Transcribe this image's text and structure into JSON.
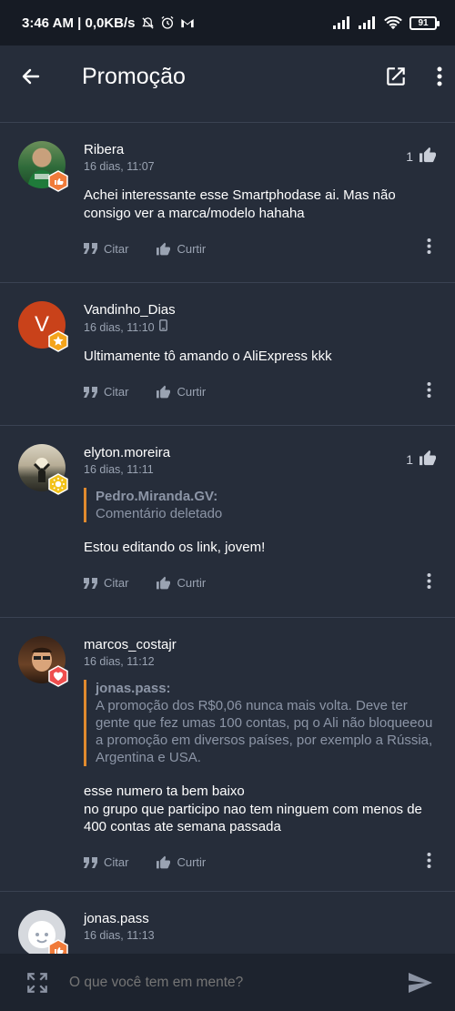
{
  "status_bar": {
    "time_speed": "3:46 AM | 0,0KB/s",
    "battery": "91"
  },
  "app_bar": {
    "title": "Promoção",
    "icons": [
      "back-arrow-icon",
      "open-external-icon",
      "more-vert-icon"
    ]
  },
  "comments": [
    {
      "user": "Ribera",
      "time": "16 dias, 11:07",
      "likes": "1",
      "text": "Achei interessante esse Smartphodase ai. Mas não consigo ver a marca/modelo hahaha",
      "cite_label": "Citar",
      "like_label": "Curtir"
    },
    {
      "user": "Vandinho_Dias",
      "avatar_letter": "V",
      "time": "16 dias, 11:10",
      "text": "Ultimamente tô amando o AliExpress kkk",
      "cite_label": "Citar",
      "like_label": "Curtir"
    },
    {
      "user": "elyton.moreira",
      "time": "16 dias, 11:11",
      "likes": "1",
      "quote_author": "Pedro.Miranda.GV:",
      "quote_text": "Comentário deletado",
      "text": "Estou editando os link, jovem!",
      "cite_label": "Citar",
      "like_label": "Curtir"
    },
    {
      "user": "marcos_costajr",
      "time": "16 dias, 11:12",
      "quote_author": "jonas.pass:",
      "quote_text": "A promoção dos R$0,06 nunca mais volta. Deve ter gente que fez umas 100 contas, pq o Ali não bloqueeou a promoção em diversos países, por exemplo a Rússia, Argentina e USA.",
      "text_lines": [
        "esse numero ta bem baixo",
        "no grupo que participo nao tem ninguem com menos de 400 contas ate semana passada"
      ],
      "cite_label": "Citar",
      "like_label": "Curtir"
    },
    {
      "user": "jonas.pass",
      "time": "16 dias, 11:13"
    }
  ],
  "input": {
    "placeholder": "O que você tem em mente?"
  },
  "colors": {
    "background": "#262d3a",
    "status_bar": "#161b24",
    "quote_bar": "#e08a2e",
    "muted_text": "#9aa3b2"
  }
}
